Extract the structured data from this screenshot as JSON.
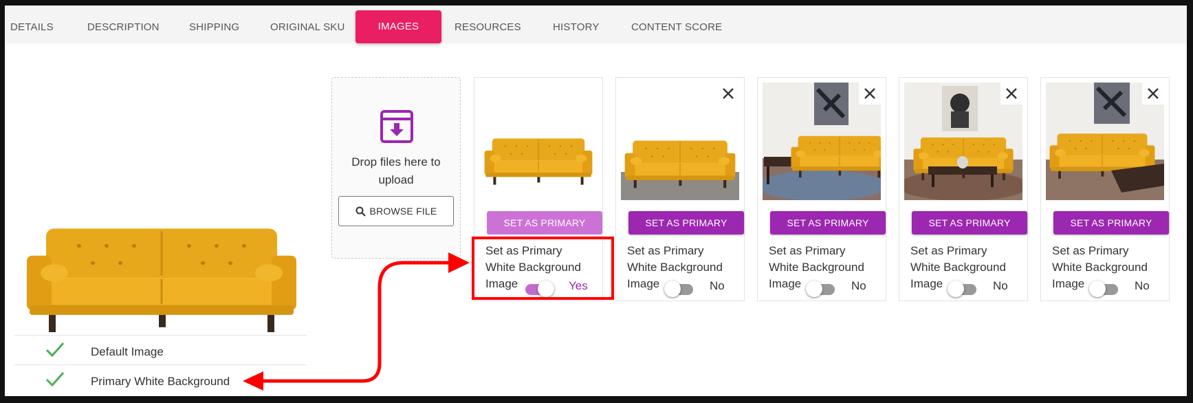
{
  "tabs": [
    {
      "label": "DETAILS",
      "active": false
    },
    {
      "label": "DESCRIPTION",
      "active": false
    },
    {
      "label": "SHIPPING",
      "active": false
    },
    {
      "label": "ORIGINAL SKU",
      "active": false
    },
    {
      "label": "IMAGES",
      "active": true
    },
    {
      "label": "RESOURCES",
      "active": false
    },
    {
      "label": "HISTORY",
      "active": false
    },
    {
      "label": "CONTENT SCORE",
      "active": false
    }
  ],
  "primary_panel": {
    "image_icon": "yellow-sofa-image",
    "rows": [
      {
        "label": "Default Image",
        "icon": "check-icon"
      },
      {
        "label": "Primary White Background",
        "icon": "check-icon"
      }
    ]
  },
  "upload": {
    "icon": "archive-download-icon",
    "drop_text": "Drop files here to upload",
    "browse_label": "BROWSE FILE",
    "browse_icon": "search-icon"
  },
  "cards": [
    {
      "image": "sofa-white-background",
      "has_close": false,
      "button_label": "SET AS PRIMARY",
      "button_disabled": true,
      "label_line1": "Set as Primary",
      "label_line2": "White Background",
      "label_line3": "Image",
      "toggle_on": true,
      "state": "Yes"
    },
    {
      "image": "sofa-gray-floor",
      "has_close": true,
      "button_label": "SET AS PRIMARY",
      "button_disabled": false,
      "label_line1": "Set as Primary",
      "label_line2": "White Background",
      "label_line3": "Image",
      "toggle_on": false,
      "state": "No"
    },
    {
      "image": "sofa-living-room-side",
      "has_close": true,
      "button_label": "SET AS PRIMARY",
      "button_disabled": false,
      "label_line1": "Set as Primary",
      "label_line2": "White Background",
      "label_line3": "Image",
      "toggle_on": false,
      "state": "No"
    },
    {
      "image": "sofa-living-room-front",
      "has_close": true,
      "button_label": "SET AS PRIMARY",
      "button_disabled": false,
      "label_line1": "Set as Primary",
      "label_line2": "White Background",
      "label_line3": "Image",
      "toggle_on": false,
      "state": "No"
    },
    {
      "image": "sofa-living-room-angle",
      "has_close": true,
      "button_label": "SET AS PRIMARY",
      "button_disabled": false,
      "label_line1": "Set as Primary",
      "label_line2": "White Background",
      "label_line3": "Image",
      "toggle_on": false,
      "state": "No"
    }
  ],
  "colors": {
    "tab_active": "#e91e63",
    "button": "#9c27b0",
    "button_disabled": "#cc72d6",
    "check": "#4caf50",
    "annotation": "#ff0000"
  }
}
